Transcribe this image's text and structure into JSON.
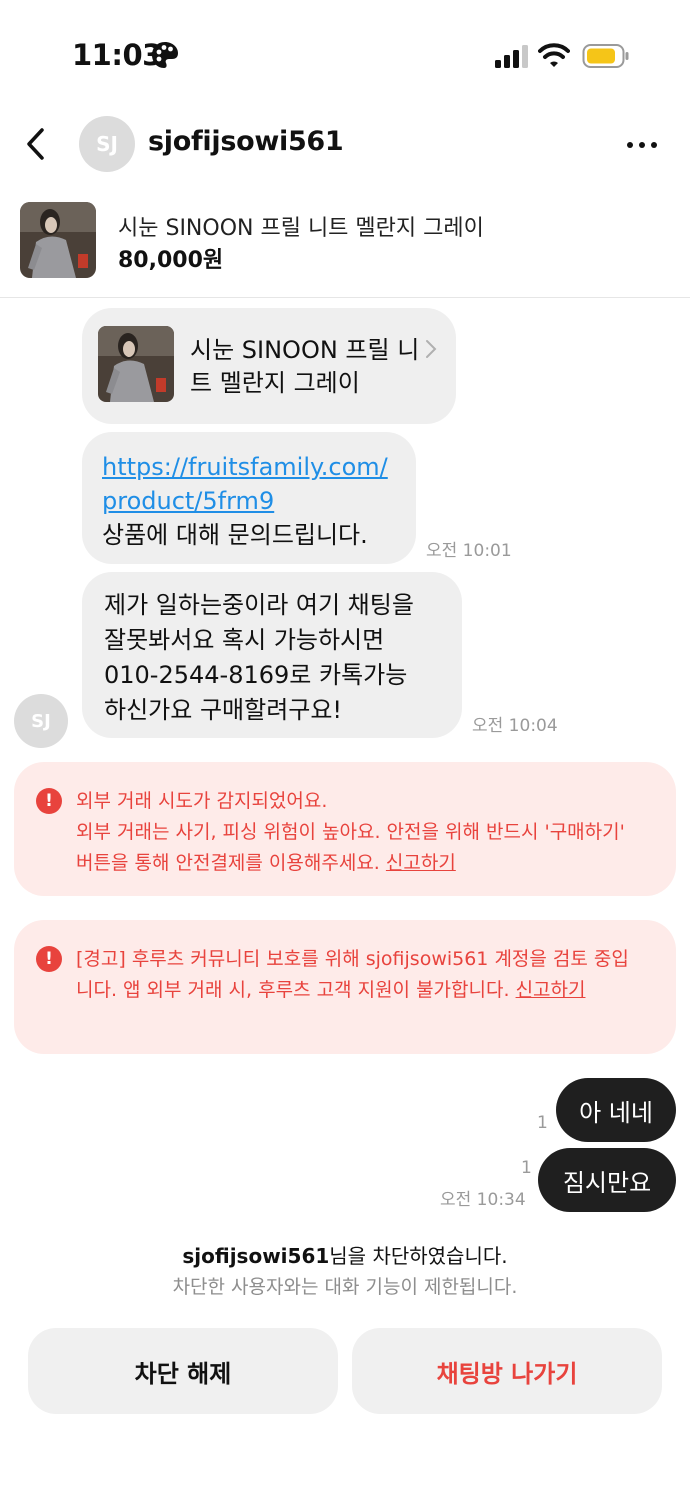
{
  "status_bar": {
    "time": "11:03"
  },
  "header": {
    "avatar_initials": "SJ",
    "username": "sjofijsowi561"
  },
  "product": {
    "title": "시눈 SINOON 프릴 니트 멜란지 그레이",
    "price": "80,000원"
  },
  "messages": {
    "card_title": "시눈 SINOON 프릴 니트 멜란지 그레이",
    "link_text": "https://fruitsfamily.com/\nproduct/5frm9",
    "link_message": "상품에 대해 문의드립니다.",
    "link_time": "오전 10:01",
    "text_message": "제가 일하는중이라 여기 채팅을\n잘못봐서요 혹시 가능하시면\n010-2544-8169로 카톡가능\n하신가요 구매할려구요!",
    "text_time": "오전 10:04",
    "sender_initials": "SJ"
  },
  "warnings": [
    {
      "text": "외부 거래 시도가 감지되었어요.\n외부 거래는 사기, 피싱 위험이 높아요. 안전을 위해 반드시 '구매하기' 버튼을 통해 안전결제를 이용해주세요. ",
      "report": "신고하기"
    },
    {
      "text": "[경고] 후루츠 커뮤니티 보호를 위해 sjofijsowi561 계정을 검토 중입니다. 앱 외부 거래 시, 후루츠 고객 지원이 불가합니다. ",
      "report": "신고하기"
    }
  ],
  "outgoing": [
    {
      "text": "아 네네",
      "read_count": "1"
    },
    {
      "text": "짐시만요",
      "read_count": "1",
      "time": "오전 10:34"
    }
  ],
  "blocked": {
    "username": "sjofijsowi561",
    "suffix": "님을 차단하였습니다.",
    "subtext": "차단한 사용자와는 대화 기능이 제한됩니다."
  },
  "actions": {
    "unblock": "차단 해제",
    "leave": "채팅방 나가기"
  },
  "colors": {
    "accent_red": "#e8433d",
    "warning_bg": "#feebe9",
    "link_blue": "#1f8ee6",
    "outgoing_bubble": "#1f1f1f",
    "battery": "#f5c518"
  }
}
